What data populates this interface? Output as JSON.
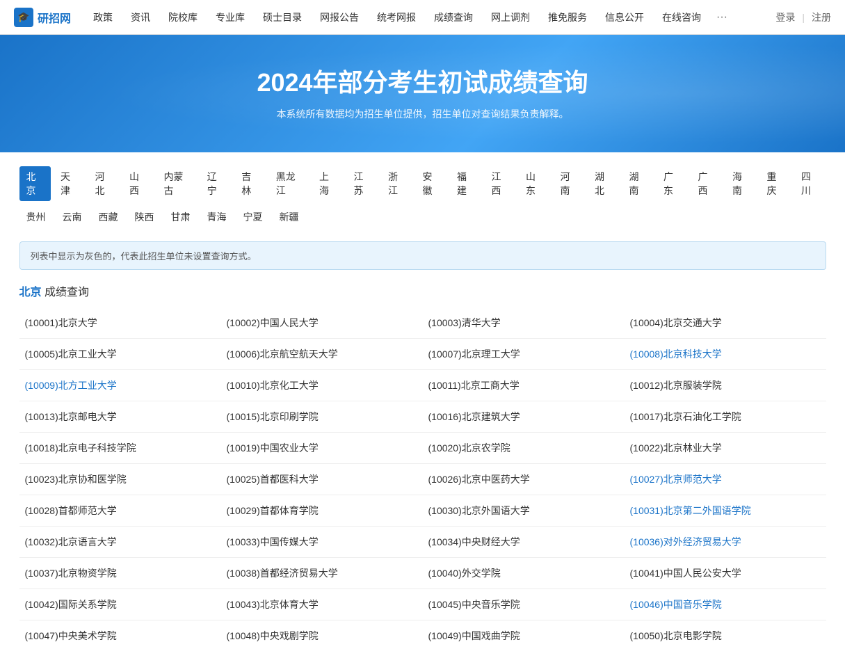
{
  "nav": {
    "logo_text": "研招网",
    "items": [
      "政策",
      "资讯",
      "院校库",
      "专业库",
      "硕士目录",
      "网报公告",
      "统考网报",
      "成绩查询",
      "网上调剂",
      "推免服务",
      "信息公开",
      "在线咨询",
      "···"
    ],
    "login": "登录",
    "sep": "|",
    "register": "注册"
  },
  "hero": {
    "title": "2024年部分考生初试成绩查询",
    "subtitle": "本系统所有数据均为招生单位提供，招生单位对查询结果负责解释。"
  },
  "provinces_row1": [
    "北京",
    "天津",
    "河北",
    "山西",
    "内蒙古",
    "辽宁",
    "吉林",
    "黑龙江",
    "上海",
    "江苏",
    "浙江",
    "安徽",
    "福建",
    "江西",
    "山东",
    "河南",
    "湖北",
    "湖南",
    "广东",
    "广西",
    "海南",
    "重庆",
    "四川"
  ],
  "provinces_row2": [
    "贵州",
    "云南",
    "西藏",
    "陕西",
    "甘肃",
    "青海",
    "宁夏",
    "新疆"
  ],
  "active_province": "北京",
  "info_text": "列表中显示为灰色的，代表此招生单位未设置查询方式。",
  "section": {
    "province": "北京",
    "suffix": " 成绩查询"
  },
  "universities": [
    [
      {
        "code": "10001",
        "name": "北京大学",
        "link": false
      },
      {
        "code": "10002",
        "name": "中国人民大学",
        "link": false
      },
      {
        "code": "10003",
        "name": "清华大学",
        "link": false
      },
      {
        "code": "10004",
        "name": "北京交通大学",
        "link": false
      }
    ],
    [
      {
        "code": "10005",
        "name": "北京工业大学",
        "link": false
      },
      {
        "code": "10006",
        "name": "北京航空航天大学",
        "link": false
      },
      {
        "code": "10007",
        "name": "北京理工大学",
        "link": false
      },
      {
        "code": "10008",
        "name": "北京科技大学",
        "link": true
      }
    ],
    [
      {
        "code": "10009",
        "name": "北方工业大学",
        "link": true
      },
      {
        "code": "10010",
        "name": "北京化工大学",
        "link": false
      },
      {
        "code": "10011",
        "name": "北京工商大学",
        "link": false
      },
      {
        "code": "10012",
        "name": "北京服装学院",
        "link": false
      }
    ],
    [
      {
        "code": "10013",
        "name": "北京邮电大学",
        "link": false
      },
      {
        "code": "10015",
        "name": "北京印刷学院",
        "link": false
      },
      {
        "code": "10016",
        "name": "北京建筑大学",
        "link": false
      },
      {
        "code": "10017",
        "name": "北京石油化工学院",
        "link": false
      }
    ],
    [
      {
        "code": "10018",
        "name": "北京电子科技学院",
        "link": false
      },
      {
        "code": "10019",
        "name": "中国农业大学",
        "link": false
      },
      {
        "code": "10020",
        "name": "北京农学院",
        "link": false
      },
      {
        "code": "10022",
        "name": "北京林业大学",
        "link": false
      }
    ],
    [
      {
        "code": "10023",
        "name": "北京协和医学院",
        "link": false
      },
      {
        "code": "10025",
        "name": "首都医科大学",
        "link": false
      },
      {
        "code": "10026",
        "name": "北京中医药大学",
        "link": false
      },
      {
        "code": "10027",
        "name": "北京师范大学",
        "link": true
      }
    ],
    [
      {
        "code": "10028",
        "name": "首都师范大学",
        "link": false
      },
      {
        "code": "10029",
        "name": "首都体育学院",
        "link": false
      },
      {
        "code": "10030",
        "name": "北京外国语大学",
        "link": false
      },
      {
        "code": "10031",
        "name": "北京第二外国语学院",
        "link": true
      }
    ],
    [
      {
        "code": "10032",
        "name": "北京语言大学",
        "link": false
      },
      {
        "code": "10033",
        "name": "中国传媒大学",
        "link": false
      },
      {
        "code": "10034",
        "name": "中央财经大学",
        "link": false
      },
      {
        "code": "10036",
        "name": "对外经济贸易大学",
        "link": true
      }
    ],
    [
      {
        "code": "10037",
        "name": "北京物资学院",
        "link": false
      },
      {
        "code": "10038",
        "name": "首都经济贸易大学",
        "link": false
      },
      {
        "code": "10040",
        "name": "外交学院",
        "link": false
      },
      {
        "code": "10041",
        "name": "中国人民公安大学",
        "link": false
      }
    ],
    [
      {
        "code": "10042",
        "name": "国际关系学院",
        "link": false
      },
      {
        "code": "10043",
        "name": "北京体育大学",
        "link": false
      },
      {
        "code": "10045",
        "name": "中央音乐学院",
        "link": false
      },
      {
        "code": "10046",
        "name": "中国音乐学院",
        "link": true
      }
    ],
    [
      {
        "code": "10047",
        "name": "中央美术学院",
        "link": false
      },
      {
        "code": "10048",
        "name": "中央戏剧学院",
        "link": false
      },
      {
        "code": "10049",
        "name": "中国戏曲学院",
        "link": false
      },
      {
        "code": "10050",
        "name": "北京电影学院",
        "link": false
      }
    ]
  ]
}
